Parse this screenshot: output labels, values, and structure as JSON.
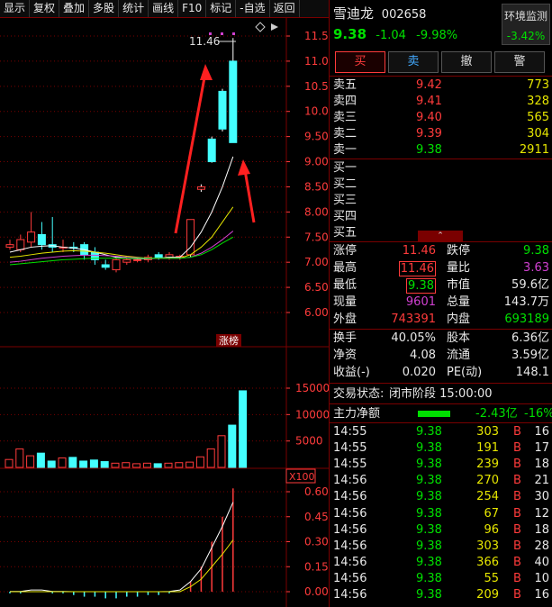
{
  "toolbar": [
    "显示",
    "复权",
    "叠加",
    "多股",
    "统计",
    "画线",
    "F10",
    "标记",
    "-自选",
    "返回"
  ],
  "stock": {
    "name": "雪迪龙",
    "code": "002658",
    "price": "9.38",
    "change": "-1.04",
    "pct": "-9.98%",
    "monitor_label": "环境监测",
    "monitor_pct": "-3.42%"
  },
  "trade_buttons": [
    "买",
    "卖",
    "撤",
    "警"
  ],
  "asks": [
    {
      "label": "卖五",
      "price": "9.42",
      "vol": "773"
    },
    {
      "label": "卖四",
      "price": "9.41",
      "vol": "328"
    },
    {
      "label": "卖三",
      "price": "9.40",
      "vol": "565"
    },
    {
      "label": "卖二",
      "price": "9.39",
      "vol": "304"
    },
    {
      "label": "卖一",
      "price": "9.38",
      "vol": "2911"
    }
  ],
  "bids": [
    "买一",
    "买二",
    "买三",
    "买四",
    "买五"
  ],
  "stats": [
    [
      {
        "l": "涨停",
        "v": "11.46",
        "c": "red"
      },
      {
        "l": "跌停",
        "v": "9.38",
        "c": "green"
      }
    ],
    [
      {
        "l": "最高",
        "v": "11.46",
        "c": "red",
        "box": true
      },
      {
        "l": "量比",
        "v": "3.63",
        "c": "purple"
      }
    ],
    [
      {
        "l": "最低",
        "v": "9.38",
        "c": "green",
        "box": true
      },
      {
        "l": "市值",
        "v": "59.6亿",
        "c": "white"
      }
    ],
    [
      {
        "l": "现量",
        "v": "9601",
        "c": "purple"
      },
      {
        "l": "总量",
        "v": "143.7万",
        "c": "white"
      }
    ],
    [
      {
        "l": "外盘",
        "v": "743391",
        "c": "red"
      },
      {
        "l": "内盘",
        "v": "693189",
        "c": "green"
      }
    ]
  ],
  "stats2": [
    [
      {
        "l": "换手",
        "v": "40.05%"
      },
      {
        "l": "股本",
        "v": "6.36亿"
      }
    ],
    [
      {
        "l": "净资",
        "v": "4.08"
      },
      {
        "l": "流通",
        "v": "3.59亿"
      }
    ],
    [
      {
        "l": "收益(-)",
        "v": "0.020"
      },
      {
        "l": "PE(动)",
        "v": "148.1"
      }
    ]
  ],
  "status": {
    "label": "交易状态:",
    "value": "闭市阶段 15:00:00"
  },
  "mainflow": {
    "label": "主力净额",
    "value": "-2.43亿",
    "pct": "-16%"
  },
  "ticks": [
    {
      "t": "14:55",
      "p": "9.38",
      "v": "303",
      "s": "B",
      "n": "16"
    },
    {
      "t": "14:55",
      "p": "9.38",
      "v": "191",
      "s": "B",
      "n": "17"
    },
    {
      "t": "14:55",
      "p": "9.38",
      "v": "239",
      "s": "B",
      "n": "18"
    },
    {
      "t": "14:56",
      "p": "9.38",
      "v": "270",
      "s": "B",
      "n": "21"
    },
    {
      "t": "14:56",
      "p": "9.38",
      "v": "254",
      "s": "B",
      "n": "30"
    },
    {
      "t": "14:56",
      "p": "9.38",
      "v": "67",
      "s": "B",
      "n": "12"
    },
    {
      "t": "14:56",
      "p": "9.38",
      "v": "96",
      "s": "B",
      "n": "18"
    },
    {
      "t": "14:56",
      "p": "9.38",
      "v": "303",
      "s": "B",
      "n": "28"
    },
    {
      "t": "14:56",
      "p": "9.38",
      "v": "366",
      "s": "B",
      "n": "40"
    },
    {
      "t": "14:56",
      "p": "9.38",
      "v": "55",
      "s": "B",
      "n": "10"
    },
    {
      "t": "14:56",
      "p": "9.38",
      "v": "209",
      "s": "B",
      "n": "16"
    }
  ],
  "chart_data": {
    "type": "candlestick",
    "price_axis": [
      "11.50",
      "11.00",
      "10.50",
      "10.00",
      "9.50",
      "9.00",
      "8.50",
      "8.00",
      "7.50",
      "7.00",
      "6.50",
      "6.00"
    ],
    "high_label": "11.46",
    "tag": "涨榜",
    "volume_axis": [
      "15000",
      "10000",
      "5000"
    ],
    "volume_unit": "X100",
    "macd_axis": [
      "0.60",
      "0.45",
      "0.30",
      "0.15",
      "0.00"
    ],
    "candles": [
      {
        "o": 7.3,
        "c": 7.35,
        "h": 7.45,
        "l": 7.25
      },
      {
        "o": 7.25,
        "c": 7.45,
        "h": 7.55,
        "l": 7.2
      },
      {
        "o": 7.4,
        "c": 7.6,
        "h": 8.0,
        "l": 7.3
      },
      {
        "o": 7.55,
        "c": 7.35,
        "h": 7.8,
        "l": 7.25
      },
      {
        "o": 7.35,
        "c": 7.3,
        "h": 7.9,
        "l": 7.2
      },
      {
        "o": 7.3,
        "c": 7.3,
        "h": 7.45,
        "l": 7.2
      },
      {
        "o": 7.3,
        "c": 7.28,
        "h": 7.4,
        "l": 7.2
      },
      {
        "o": 7.35,
        "c": 7.15,
        "h": 7.4,
        "l": 7.05
      },
      {
        "o": 7.2,
        "c": 7.05,
        "h": 7.3,
        "l": 6.95
      },
      {
        "o": 6.95,
        "c": 6.9,
        "h": 7.05,
        "l": 6.85
      },
      {
        "o": 6.85,
        "c": 7.05,
        "h": 7.1,
        "l": 6.8
      },
      {
        "o": 7.0,
        "c": 7.05,
        "h": 7.1,
        "l": 6.95
      },
      {
        "o": 7.05,
        "c": 7.05,
        "h": 7.1,
        "l": 7.0
      },
      {
        "o": 7.05,
        "c": 7.1,
        "h": 7.15,
        "l": 7.0
      },
      {
        "o": 7.15,
        "c": 7.1,
        "h": 7.2,
        "l": 7.05
      },
      {
        "o": 7.1,
        "c": 7.15,
        "h": 7.2,
        "l": 7.05
      },
      {
        "o": 7.1,
        "c": 7.12,
        "h": 7.15,
        "l": 7.05
      },
      {
        "o": 7.15,
        "c": 7.85,
        "h": 7.85,
        "l": 7.1
      },
      {
        "o": 8.45,
        "c": 8.5,
        "h": 8.55,
        "l": 8.4
      },
      {
        "o": 9.45,
        "c": 9.0,
        "h": 9.5,
        "l": 8.98
      },
      {
        "o": 10.4,
        "c": 9.65,
        "h": 10.45,
        "l": 9.6
      },
      {
        "o": 11.0,
        "c": 9.38,
        "h": 11.46,
        "l": 9.38
      }
    ],
    "volumes": [
      1500,
      3500,
      2200,
      2700,
      1200,
      1800,
      1900,
      1200,
      1400,
      1100,
      800,
      900,
      700,
      800,
      700,
      800,
      900,
      1000,
      2000,
      3500,
      6000,
      8000,
      14500
    ]
  },
  "colors": {
    "up": "#ff3b3b",
    "down": "#44ffff",
    "grid": "#7a0000",
    "axis": "#ff3b3b"
  }
}
